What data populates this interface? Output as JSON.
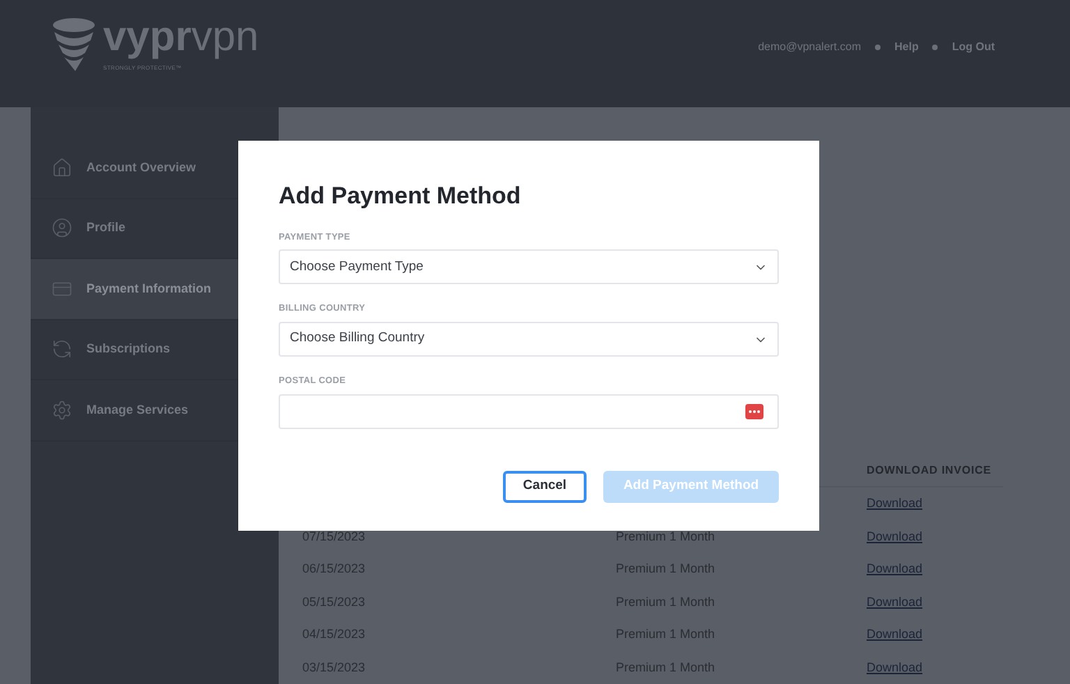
{
  "header": {
    "logo": {
      "brand_bold": "vypr",
      "brand_light": "vpn",
      "tagline": "STRONGLY PROTECTIVE™"
    },
    "nav": [
      {
        "label": "demo@vpnalert.com",
        "kind": "text"
      },
      {
        "label": "Help",
        "kind": "link"
      },
      {
        "label": "Log Out",
        "kind": "link"
      }
    ]
  },
  "sidebar": {
    "items": [
      {
        "label": "Account Overview",
        "selected": false
      },
      {
        "label": "Profile",
        "selected": false
      },
      {
        "label": "Payment Information",
        "selected": true
      },
      {
        "label": "Subscriptions",
        "selected": false
      },
      {
        "label": "Manage Services",
        "selected": false
      }
    ]
  },
  "invoices": {
    "columns": [
      {
        "label": "DOWNLOAD INVOICE"
      }
    ],
    "rows": [
      {
        "download": "Download"
      },
      {
        "date": "07/15/2023",
        "plan": "Premium 1 Month",
        "download": "Download"
      },
      {
        "date": "06/15/2023",
        "plan": "Premium 1 Month",
        "download": "Download"
      },
      {
        "date": "05/15/2023",
        "plan": "Premium 1 Month",
        "download": "Download"
      },
      {
        "date": "04/15/2023",
        "plan": "Premium 1 Month",
        "download": "Download"
      },
      {
        "date": "03/15/2023",
        "plan": "Premium 1 Month",
        "download": "Download"
      }
    ]
  },
  "modal": {
    "title": "Add Payment Method",
    "fields": [
      {
        "label": "PAYMENT TYPE",
        "kind": "select",
        "placeholder": "Choose Payment Type"
      },
      {
        "label": "BILLING COUNTRY",
        "kind": "select",
        "placeholder": "Choose Billing Country"
      },
      {
        "label": "POSTAL CODE",
        "kind": "input"
      }
    ],
    "buttons": [
      {
        "label": "Cancel",
        "kind": "secondary",
        "disabled": false
      },
      {
        "label": "Add Payment Method",
        "kind": "primary",
        "disabled": true
      }
    ]
  }
}
